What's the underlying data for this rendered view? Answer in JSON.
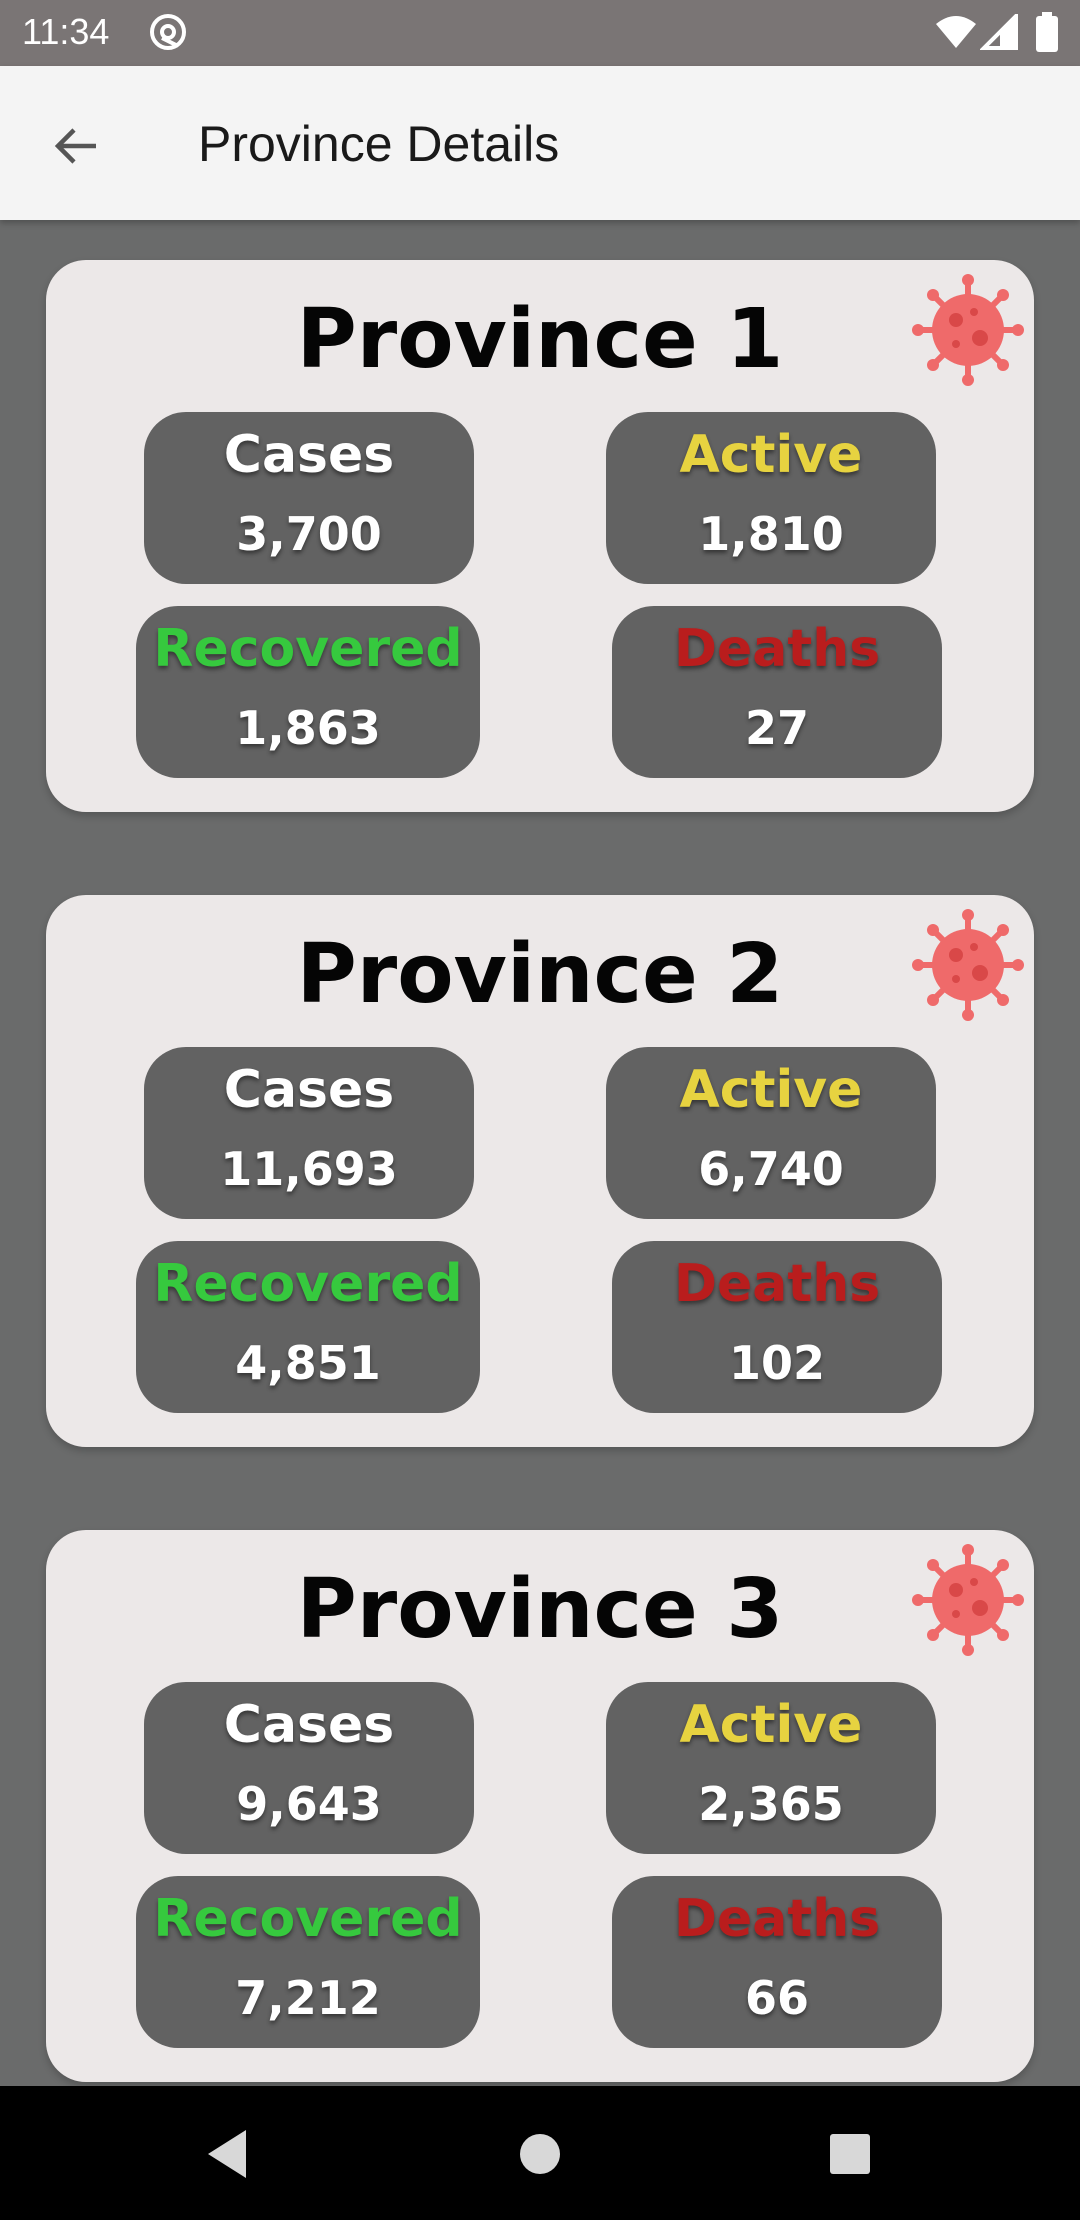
{
  "status_bar": {
    "time": "11:34",
    "icons": [
      "at-sign-icon",
      "wifi-icon",
      "signal-icon",
      "battery-icon"
    ]
  },
  "app_bar": {
    "title": "Province Details",
    "back_icon": "arrow-left-icon"
  },
  "colors": {
    "cases_label": "#ffffff",
    "active_label": "#e7d340",
    "recovered_label": "#36c93e",
    "deaths_label": "#b91d1d",
    "card_bg": "#ece8e8",
    "stat_bg": "#626262",
    "virus_icon": "#ef6a6a"
  },
  "provinces": [
    {
      "name": "Province 1",
      "icon": "virus-icon",
      "cases": {
        "label": "Cases",
        "value": "3,700"
      },
      "active": {
        "label": "Active",
        "value": "1,810"
      },
      "recovered": {
        "label": "Recovered",
        "value": "1,863"
      },
      "deaths": {
        "label": "Deaths",
        "value": "27"
      }
    },
    {
      "name": "Province 2",
      "icon": "virus-icon",
      "cases": {
        "label": "Cases",
        "value": "11,693"
      },
      "active": {
        "label": "Active",
        "value": "6,740"
      },
      "recovered": {
        "label": "Recovered",
        "value": "4,851"
      },
      "deaths": {
        "label": "Deaths",
        "value": "102"
      }
    },
    {
      "name": "Province 3",
      "icon": "virus-icon",
      "cases": {
        "label": "Cases",
        "value": "9,643"
      },
      "active": {
        "label": "Active",
        "value": "2,365"
      },
      "recovered": {
        "label": "Recovered",
        "value": "7,212"
      },
      "deaths": {
        "label": "Deaths",
        "value": "66"
      }
    }
  ],
  "nav_bar": {
    "buttons": [
      "back-triangle-icon",
      "home-circle-icon",
      "recents-square-icon"
    ]
  }
}
